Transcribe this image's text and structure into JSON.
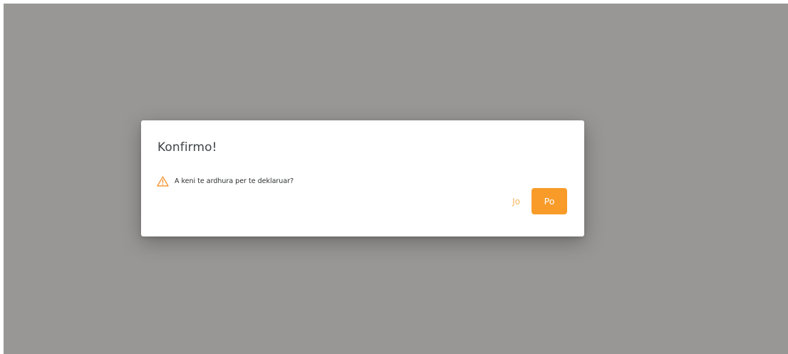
{
  "dialog": {
    "title": "Konfirmo!",
    "message": "A keni te ardhura per te deklaruar?",
    "icon": "warning-icon",
    "no_label": "Jo",
    "yes_label": "Po"
  },
  "colors": {
    "overlay": "#989795",
    "accent": "#f89b29",
    "secondary_text": "#f7b45a",
    "warning": "#f5983a"
  }
}
